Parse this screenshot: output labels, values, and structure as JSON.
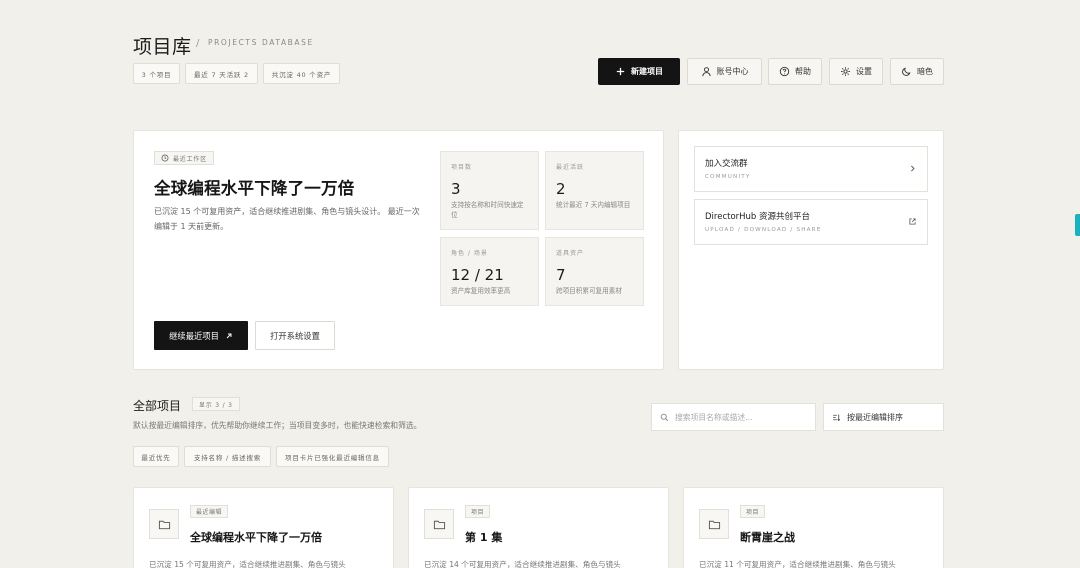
{
  "header": {
    "title": "项目库",
    "separator": "/",
    "subtitle": "PROJECTS DATABASE",
    "chips": [
      "3 个项目",
      "最近 7 天活跃 2",
      "共沉淀 40 个资产"
    ]
  },
  "toolbar": {
    "new_project": "新建项目",
    "account": "账号中心",
    "help": "帮助",
    "settings": "设置",
    "theme": "暗色"
  },
  "hero": {
    "badge": "最近工作区",
    "title": "全球编程水平下降了一万倍",
    "desc": "已沉淀 15 个可复用资产，适合继续推进剧集、角色与镜头设计。 最近一次编辑于 1 天前更新。",
    "stats": [
      {
        "label": "项目数",
        "value": "3",
        "sub": "支持按名称和时间快速定位"
      },
      {
        "label": "最近活跃",
        "value": "2",
        "sub": "统计最近 7 天内编辑项目"
      },
      {
        "label": "角色 / 场景",
        "value": "12 / 21",
        "sub": "资产库复用效率更高"
      },
      {
        "label": "道具资产",
        "value": "7",
        "sub": "跨项目积累可复用素材"
      }
    ],
    "continue_btn": "继续最近项目",
    "settings_btn": "打开系统设置"
  },
  "side_links": [
    {
      "title": "加入交流群",
      "sub": "COMMUNITY",
      "icon": "chevron-right-icon"
    },
    {
      "title": "DirectorHub 资源共创平台",
      "sub": "UPLOAD / DOWNLOAD / SHARE",
      "icon": "external-link-icon"
    }
  ],
  "projects_section": {
    "title": "全部项目",
    "count_badge": "显示 3 / 3",
    "desc": "默认按最近编辑排序，优先帮助你继续工作；当项目变多时，也能快速检索和筛选。",
    "search_placeholder": "搜索项目名称或描述...",
    "sort_label": "按最近编辑排序",
    "filter_chips": [
      "最近优先",
      "支持名称 / 描述搜索",
      "项目卡片已强化最近编辑信息"
    ]
  },
  "projects": [
    {
      "tag": "最近编辑",
      "title": "全球编程水平下降了一万倍",
      "desc": "已沉淀 15 个可复用资产，适合继续推进剧集、角色与镜头"
    },
    {
      "tag": "项目",
      "title": "第 1 集",
      "desc": "已沉淀 14 个可复用资产，适合继续推进剧集、角色与镜头"
    },
    {
      "tag": "项目",
      "title": "断霄崖之战",
      "desc": "已沉淀 11 个可复用资产，适合继续推进剧集、角色与镜头"
    }
  ],
  "colors": {
    "background": "#f2f0eb",
    "primary": "#141414",
    "accent": "#1ab3bd"
  }
}
